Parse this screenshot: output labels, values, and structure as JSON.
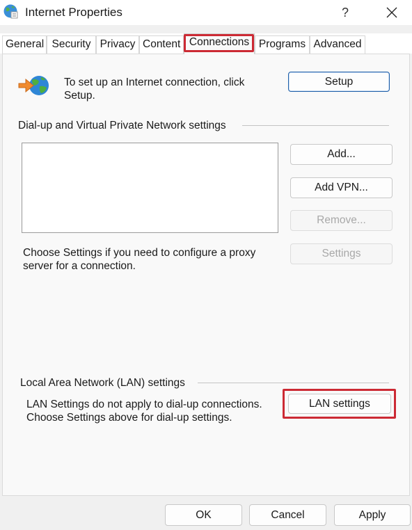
{
  "window": {
    "title": "Internet Properties",
    "help_label": "?",
    "icon": "globe-icon"
  },
  "tabs": [
    {
      "label": "General"
    },
    {
      "label": "Security"
    },
    {
      "label": "Privacy"
    },
    {
      "label": "Content"
    },
    {
      "label": "Connections",
      "active": true
    },
    {
      "label": "Programs"
    },
    {
      "label": "Advanced"
    }
  ],
  "setup": {
    "description": "To set up an Internet connection, click Setup.",
    "button_label": "Setup",
    "icon": "internet-setup-icon"
  },
  "dialup": {
    "heading": "Dial-up and Virtual Private Network settings",
    "connections": [],
    "add_label": "Add...",
    "add_vpn_label": "Add VPN...",
    "remove_label": "Remove...",
    "settings_label": "Settings",
    "proxy_text": "Choose Settings if you need to configure a proxy server for a connection."
  },
  "lan": {
    "heading": "Local Area Network (LAN) settings",
    "description": "LAN Settings do not apply to dial-up connections. Choose Settings above for dial-up settings.",
    "button_label": "LAN settings"
  },
  "footer": {
    "ok_label": "OK",
    "cancel_label": "Cancel",
    "apply_label": "Apply"
  },
  "colors": {
    "highlight": "#cc2a34",
    "accent_border": "#1f5fa8"
  }
}
